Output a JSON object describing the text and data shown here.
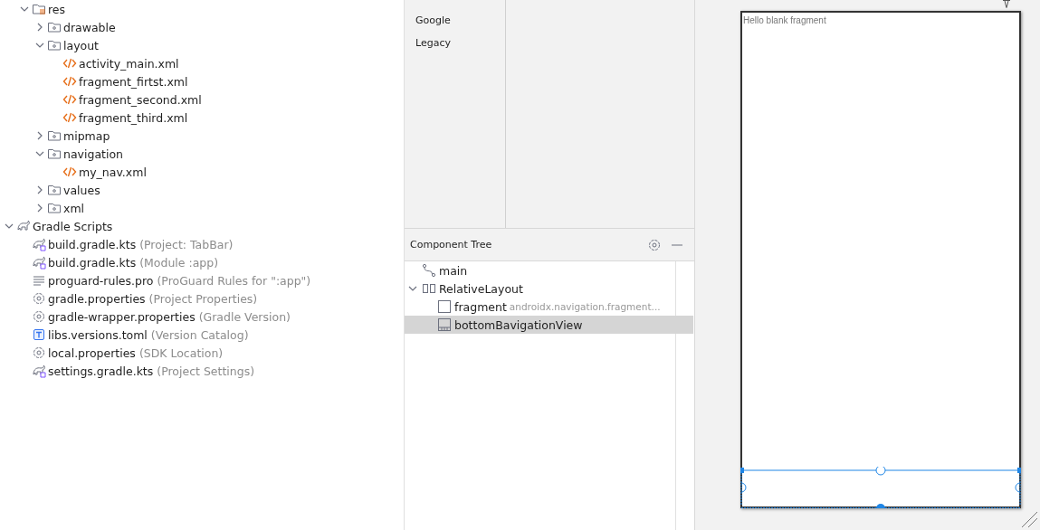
{
  "project_tree": [
    {
      "label": "res",
      "kind": "res-folder",
      "expanded": true,
      "children": [
        {
          "label": "drawable",
          "kind": "folder",
          "expanded": false
        },
        {
          "label": "layout",
          "kind": "folder",
          "expanded": true,
          "children": [
            {
              "label": "activity_main.xml",
              "kind": "xml"
            },
            {
              "label": "fragment_firtst.xml",
              "kind": "xml"
            },
            {
              "label": "fragment_second.xml",
              "kind": "xml"
            },
            {
              "label": "fragment_third.xml",
              "kind": "xml"
            }
          ]
        },
        {
          "label": "mipmap",
          "kind": "folder",
          "expanded": false
        },
        {
          "label": "navigation",
          "kind": "folder",
          "expanded": true,
          "children": [
            {
              "label": "my_nav.xml",
              "kind": "xml"
            }
          ]
        },
        {
          "label": "values",
          "kind": "folder",
          "expanded": false
        },
        {
          "label": "xml",
          "kind": "folder",
          "expanded": false
        }
      ]
    },
    {
      "label": "Gradle Scripts",
      "kind": "gradle",
      "expanded": true,
      "children": [
        {
          "label": "build.gradle.kts",
          "hint": "(Project: TabBar)",
          "kind": "gradle-kts"
        },
        {
          "label": "build.gradle.kts",
          "hint": "(Module :app)",
          "kind": "gradle-kts"
        },
        {
          "label": "proguard-rules.pro",
          "hint": "(ProGuard Rules for \":app\")",
          "kind": "text"
        },
        {
          "label": "gradle.properties",
          "hint": "(Project Properties)",
          "kind": "settings"
        },
        {
          "label": "gradle-wrapper.properties",
          "hint": "(Gradle Version)",
          "kind": "settings"
        },
        {
          "label": "libs.versions.toml",
          "hint": "(Version Catalog)",
          "kind": "toml"
        },
        {
          "label": "local.properties",
          "hint": "(SDK Location)",
          "kind": "settings"
        },
        {
          "label": "settings.gradle.kts",
          "hint": "(Project Settings)",
          "kind": "gradle-kts"
        }
      ]
    }
  ],
  "palette": {
    "categories": [
      "Google",
      "Legacy"
    ]
  },
  "component_tree": {
    "title": "Component Tree",
    "items": [
      {
        "label": "main",
        "kind": "navigation",
        "selected": false
      },
      {
        "label": "RelativeLayout",
        "kind": "relative-layout",
        "expanded": true,
        "selected": false,
        "children": [
          {
            "label": "fragment",
            "hint": "androidx.navigation.fragment...",
            "kind": "view",
            "selected": false
          },
          {
            "label": "bottomBavigationView",
            "kind": "bottom-nav",
            "selected": true
          }
        ]
      }
    ]
  },
  "design": {
    "text": "Hello blank fragment"
  }
}
